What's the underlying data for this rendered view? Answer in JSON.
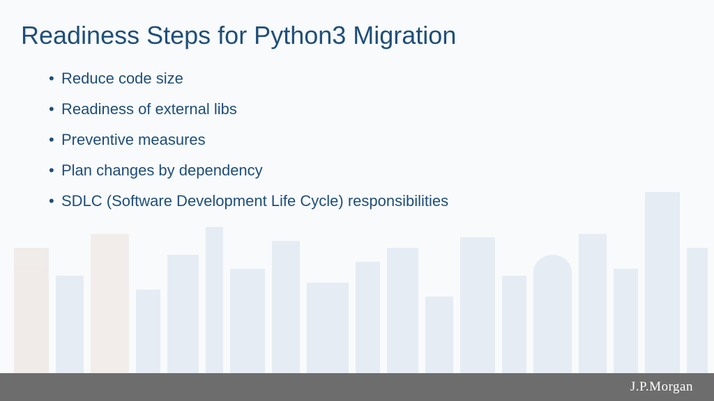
{
  "title": "Readiness Steps for Python3 Migration",
  "bullets": [
    "Reduce code size",
    "Readiness of external libs",
    "Preventive measures",
    "Plan changes by dependency",
    "SDLC (Software Development Life Cycle) responsibilities"
  ],
  "footer": {
    "logo_text": "J.P.Morgan"
  }
}
